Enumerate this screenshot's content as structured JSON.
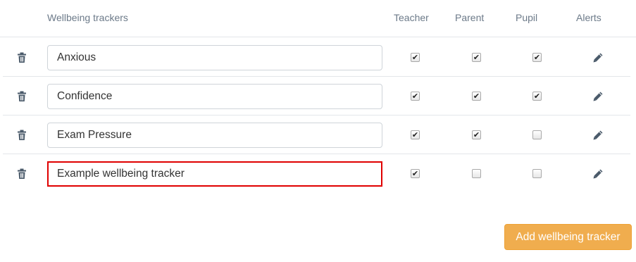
{
  "header": {
    "col_name": "Wellbeing trackers",
    "col_teacher": "Teacher",
    "col_parent": "Parent",
    "col_pupil": "Pupil",
    "col_alerts": "Alerts"
  },
  "trackers": [
    {
      "name": "Anxious",
      "teacher": true,
      "parent": true,
      "pupil": true,
      "highlighted": false
    },
    {
      "name": "Confidence",
      "teacher": true,
      "parent": true,
      "pupil": true,
      "highlighted": false
    },
    {
      "name": "Exam Pressure",
      "teacher": true,
      "parent": true,
      "pupil": false,
      "highlighted": false
    },
    {
      "name": "Example wellbeing tracker",
      "teacher": true,
      "parent": false,
      "pupil": false,
      "highlighted": true
    }
  ],
  "icons": {
    "delete": "trash-icon",
    "edit_alerts": "pencil-icon"
  },
  "add_button": {
    "label": "Add wellbeing tracker"
  },
  "colors": {
    "accent_button": "#f0ad4e",
    "highlight_border": "#e00000",
    "icon": "#4a5a6a",
    "header_text": "#6c7a89"
  }
}
